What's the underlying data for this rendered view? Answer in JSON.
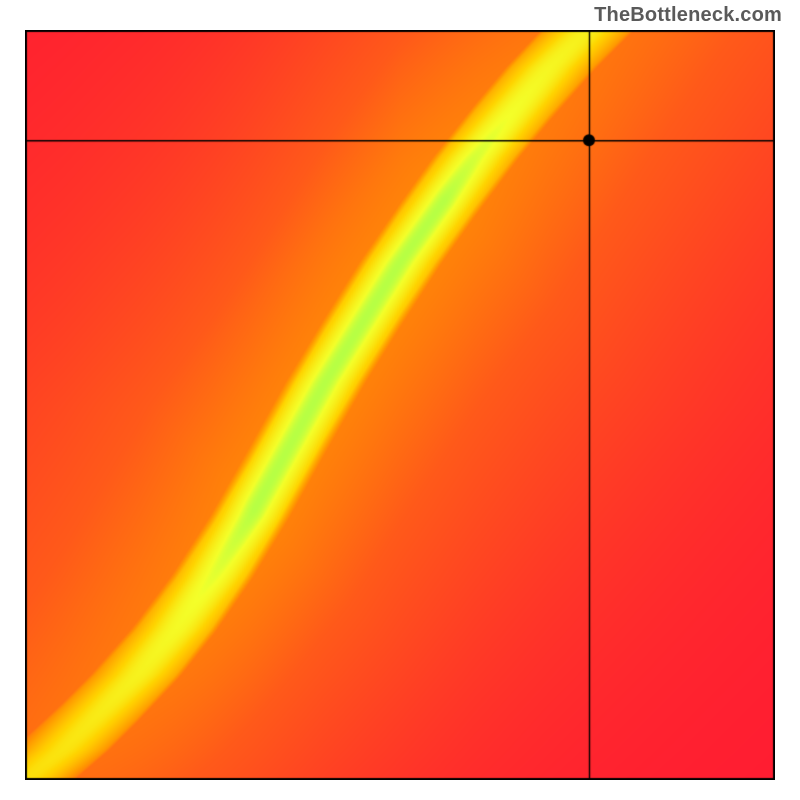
{
  "watermark": "TheBottleneck.com",
  "chart_data": {
    "type": "heatmap",
    "title": "",
    "xlabel": "",
    "ylabel": "",
    "xlim": [
      0,
      1
    ],
    "ylim": [
      0,
      1
    ],
    "marker": {
      "x": 0.752,
      "y": 0.853
    },
    "crosshair": {
      "x": 0.752,
      "y": 0.853
    },
    "ridge_points": [
      {
        "x": 0.0,
        "y": 0.0
      },
      {
        "x": 0.05,
        "y": 0.04
      },
      {
        "x": 0.1,
        "y": 0.09
      },
      {
        "x": 0.15,
        "y": 0.14
      },
      {
        "x": 0.2,
        "y": 0.2
      },
      {
        "x": 0.25,
        "y": 0.27
      },
      {
        "x": 0.3,
        "y": 0.35
      },
      {
        "x": 0.35,
        "y": 0.44
      },
      {
        "x": 0.4,
        "y": 0.53
      },
      {
        "x": 0.45,
        "y": 0.61
      },
      {
        "x": 0.5,
        "y": 0.69
      },
      {
        "x": 0.55,
        "y": 0.76
      },
      {
        "x": 0.6,
        "y": 0.83
      },
      {
        "x": 0.65,
        "y": 0.89
      },
      {
        "x": 0.7,
        "y": 0.95
      },
      {
        "x": 0.75,
        "y": 1.0
      }
    ],
    "color_stops": [
      {
        "t": 0.0,
        "color": "#ff1a33"
      },
      {
        "t": 0.35,
        "color": "#ff5a1a"
      },
      {
        "t": 0.55,
        "color": "#ff9a00"
      },
      {
        "t": 0.75,
        "color": "#ffd400"
      },
      {
        "t": 0.88,
        "color": "#f4ff2a"
      },
      {
        "t": 0.97,
        "color": "#6cff66"
      },
      {
        "t": 1.0,
        "color": "#00e58a"
      }
    ],
    "ridge_width": 0.055,
    "falloff": 2.0,
    "border_color": "#000000"
  }
}
